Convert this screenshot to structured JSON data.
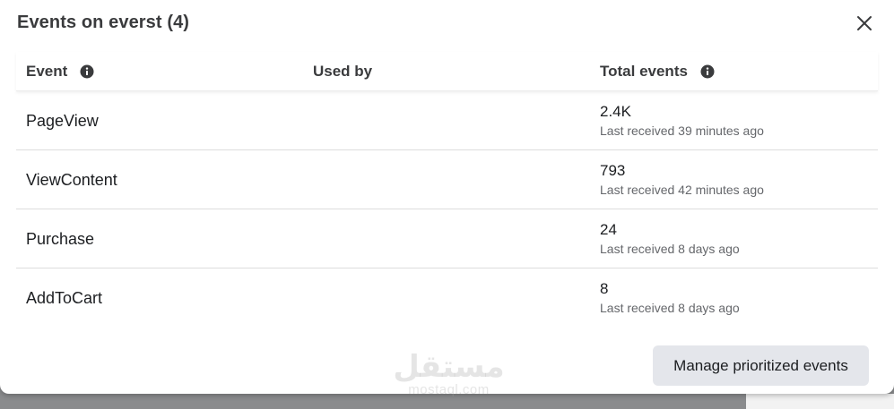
{
  "modal": {
    "title": "Events on everst (4)",
    "close_icon": "close-icon"
  },
  "table": {
    "headers": {
      "event": "Event",
      "used_by": "Used by",
      "total_events": "Total events"
    },
    "rows": [
      {
        "event": "PageView",
        "used_by": "",
        "total": "2.4K",
        "last_received": "Last received 39 minutes ago"
      },
      {
        "event": "ViewContent",
        "used_by": "",
        "total": "793",
        "last_received": "Last received 42 minutes ago"
      },
      {
        "event": "Purchase",
        "used_by": "",
        "total": "24",
        "last_received": "Last received 8 days ago"
      },
      {
        "event": "AddToCart",
        "used_by": "",
        "total": "8",
        "last_received": "Last received 8 days ago"
      }
    ]
  },
  "footer": {
    "manage_button": "Manage prioritized events"
  },
  "watermark": {
    "main": "مستقل",
    "sub": "mostaql.com"
  },
  "colors": {
    "backdrop": "#8a8b8d",
    "button_bg": "#e4e6eb",
    "text_primary": "#1c1e21",
    "text_secondary": "#65676b"
  }
}
